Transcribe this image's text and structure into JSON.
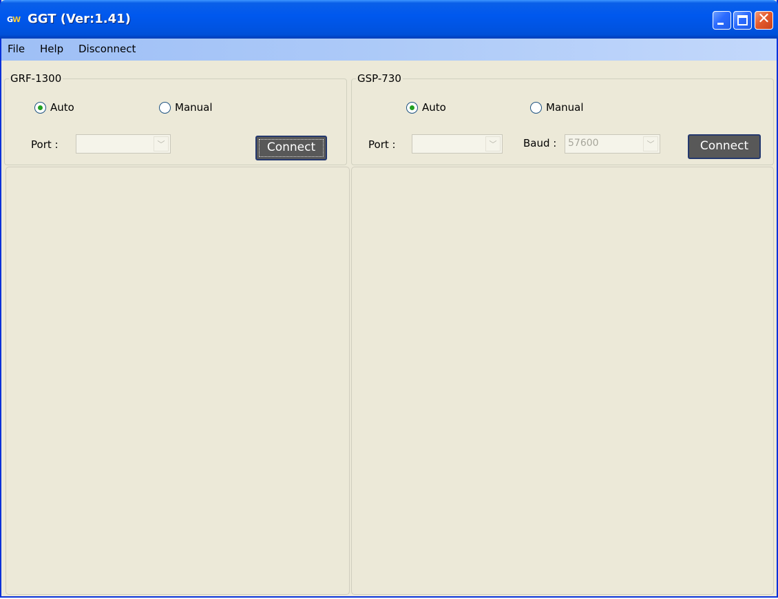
{
  "window": {
    "title": "GGT (Ver:1.41)",
    "icon": {
      "name": "gw-instek-icon",
      "text_left": "G",
      "text_right": "W"
    },
    "controls": {
      "minimize": "minimize-icon",
      "maximize": "maximize-icon",
      "close_glyph": "✕"
    }
  },
  "menu": {
    "items": [
      "File",
      "Help",
      "Disconnect"
    ]
  },
  "left_group": {
    "label": "GRF-1300",
    "radio_auto": {
      "label": "Auto",
      "checked": true
    },
    "radio_manual": {
      "label": "Manual",
      "checked": false
    },
    "port_label": "Port :",
    "port_value": "",
    "connect_label": "Connect"
  },
  "right_group": {
    "label": "GSP-730",
    "radio_auto": {
      "label": "Auto",
      "checked": true
    },
    "radio_manual": {
      "label": "Manual",
      "checked": false
    },
    "port_label": "Port :",
    "port_value": "",
    "baud_label": "Baud :",
    "baud_value": "57600",
    "connect_label": "Connect"
  },
  "colors": {
    "titlebar": "#0054E3",
    "window_bg": "#ECE9D8",
    "button_bg": "#585858",
    "radio_dot": "#21A121"
  }
}
